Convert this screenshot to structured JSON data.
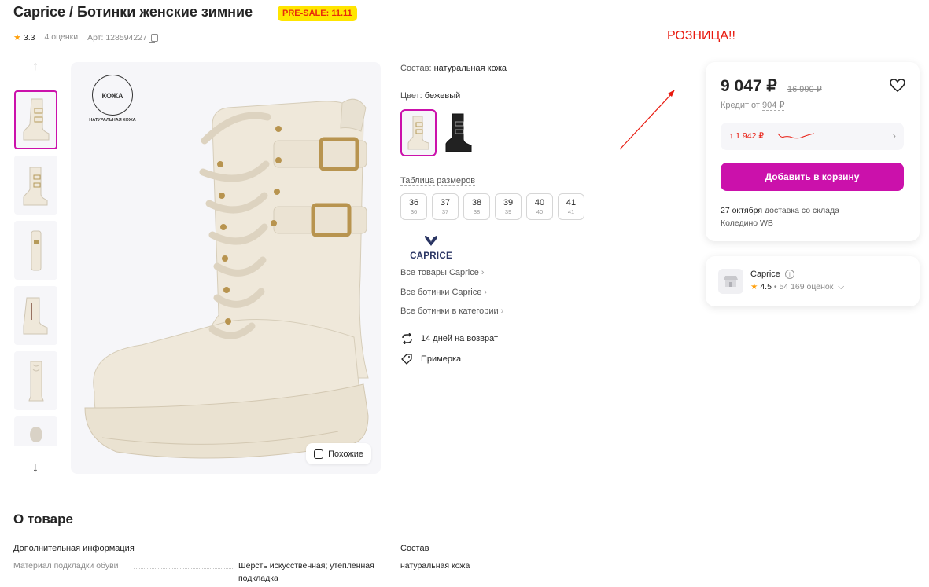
{
  "product": {
    "title": "Caprice / Ботинки женские зимние",
    "badge": "PRE-SALE: 11.11",
    "rating": "3.3",
    "reviews": "4 оценки",
    "article": "Арт: 128594227"
  },
  "annotation": {
    "text": "РОЗНИЦА!!",
    "color": "#e8190e"
  },
  "gallery": {
    "leather_badge_title": "КОЖА",
    "leather_badge_sub": "НАТУРАЛЬНАЯ КОЖА",
    "similar_label": "Похожие"
  },
  "details": {
    "composition_label": "Состав:",
    "composition_value": "натуральная кожа",
    "color_label": "Цвет:",
    "color_value": "бежевый",
    "size_table_label": "Таблица размеров",
    "sizes": [
      {
        "size": "36",
        "ru": "36"
      },
      {
        "size": "37",
        "ru": "37"
      },
      {
        "size": "38",
        "ru": "38"
      },
      {
        "size": "39",
        "ru": "39"
      },
      {
        "size": "40",
        "ru": "40"
      },
      {
        "size": "41",
        "ru": "41"
      }
    ],
    "brand_name": "CAPRICE",
    "links": [
      "Все товары Caprice",
      "Все ботинки Caprice",
      "Все ботинки в категории"
    ],
    "return_text": "14 дней на возврат",
    "fitting_text": "Примерка"
  },
  "price_card": {
    "price": "9 047 ₽",
    "old_price": "16 990 ₽",
    "credit_prefix": "Кредит от",
    "credit_value": "904 ₽",
    "price_change": "↑ 1 942 ₽",
    "add_to_cart": "Добавить в корзину",
    "delivery_date": "27 октября",
    "delivery_rest": "доставка со склада",
    "warehouse": "Коледино WB"
  },
  "seller": {
    "name": "Caprice",
    "rating": "4.5",
    "reviews": "• 54 169 оценок"
  },
  "about": {
    "title": "О товаре",
    "additional_label": "Дополнительная информация",
    "lining_label": "Материал подкладки обуви",
    "lining_value": "Шерсть искусственная; утепленная подкладка",
    "composition_label": "Состав",
    "composition_value": "натуральная кожа"
  },
  "colors": {
    "accent": "#cb11ab",
    "badge_bg": "#ffe500",
    "alert_red": "#e8190e",
    "boot_cream": "#efe8da"
  }
}
